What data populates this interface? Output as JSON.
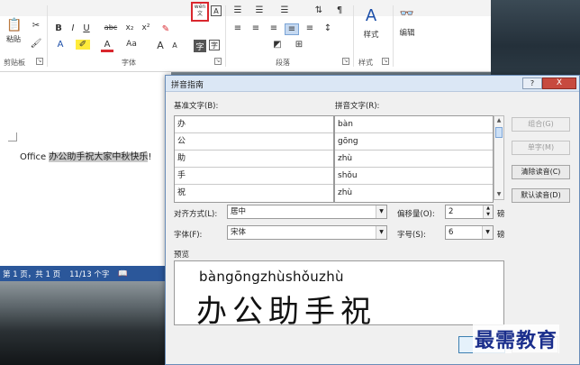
{
  "ribbon": {
    "paste_label": "粘贴",
    "groups": {
      "clipboard": "剪贴板",
      "font": "字体",
      "paragraph": "段落",
      "styles": "样式",
      "edit": "编辑"
    },
    "styles_button": "样式",
    "edit_button": "编辑",
    "font_buttons": {
      "bold": "B",
      "italic": "I",
      "underline": "U",
      "strike": "abc",
      "sub": "x₂",
      "sup": "x²",
      "grow": "A",
      "shrink": "A",
      "size_aa": "Aa"
    }
  },
  "document": {
    "text_prefix": "Office ",
    "text_selected": "办公助手祝大家中秋快乐",
    "text_suffix": "!"
  },
  "status_bar": {
    "page": "第 1 页，共 1 页",
    "words": "11/13 个字"
  },
  "dialog": {
    "title": "拼音指南",
    "col_base": "基准文字(B):",
    "col_ruby": "拼音文字(R):",
    "rows": [
      {
        "base": "办",
        "ruby": "bàn"
      },
      {
        "base": "公",
        "ruby": "gōng"
      },
      {
        "base": "助",
        "ruby": "zhù"
      },
      {
        "base": "手",
        "ruby": "shǒu"
      },
      {
        "base": "祝",
        "ruby": "zhù"
      }
    ],
    "buttons": {
      "group": "组合(G)",
      "single": "单字(M)",
      "clear": "清除读音(C)",
      "default": "默认读音(D)",
      "help": "?",
      "close": "X"
    },
    "align_label": "对齐方式(L):",
    "align_value": "居中",
    "offset_label": "偏移量(O):",
    "offset_value": "2",
    "offset_unit": "磅",
    "font_label": "字体(F):",
    "font_value": "宋体",
    "size_label": "字号(S):",
    "size_value": "6",
    "size_unit": "磅",
    "preview_label": "预览",
    "preview_pinyin": "bàngōngzhùshǒuzhù",
    "preview_text": "办公助手祝"
  },
  "watermark": "最需教育"
}
